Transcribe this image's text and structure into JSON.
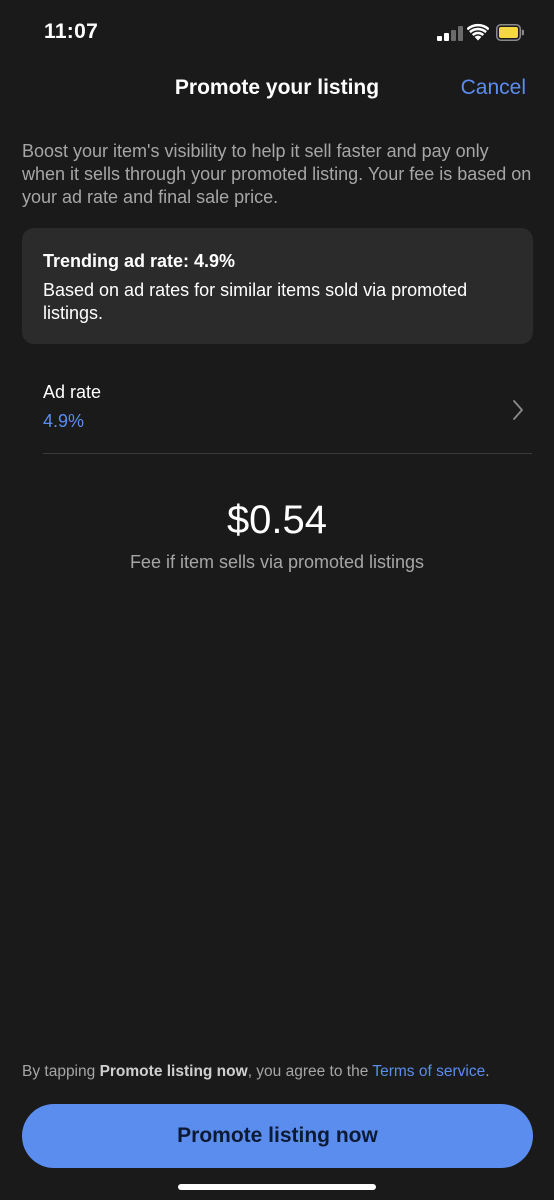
{
  "status_bar": {
    "time": "11:07",
    "battery_color": "#f5d742"
  },
  "header": {
    "title": "Promote your listing",
    "cancel_label": "Cancel"
  },
  "description": "Boost your item's visibility to help it sell faster and pay only when it sells through your promoted listing. Your fee is based on your ad rate and final sale price.",
  "trending_card": {
    "title": "Trending ad rate: 4.9%",
    "description": "Based on ad rates for similar items sold via promoted listings."
  },
  "ad_rate": {
    "label": "Ad rate",
    "value": "4.9%"
  },
  "fee": {
    "amount": "$0.54",
    "label": "Fee if item sells via promoted listings"
  },
  "agreement": {
    "prefix": "By tapping ",
    "action": "Promote listing now",
    "middle": ", you agree to the ",
    "link": "Terms of service",
    "suffix": "."
  },
  "primary_button": {
    "label": "Promote listing now"
  },
  "colors": {
    "background": "#1a1a1a",
    "card": "#2b2b2b",
    "accent": "#5b8def",
    "secondary_text": "#a6a6a6"
  },
  "icons": [
    "cellular-signal-icon",
    "wifi-icon",
    "battery-icon",
    "chevron-right-icon"
  ]
}
